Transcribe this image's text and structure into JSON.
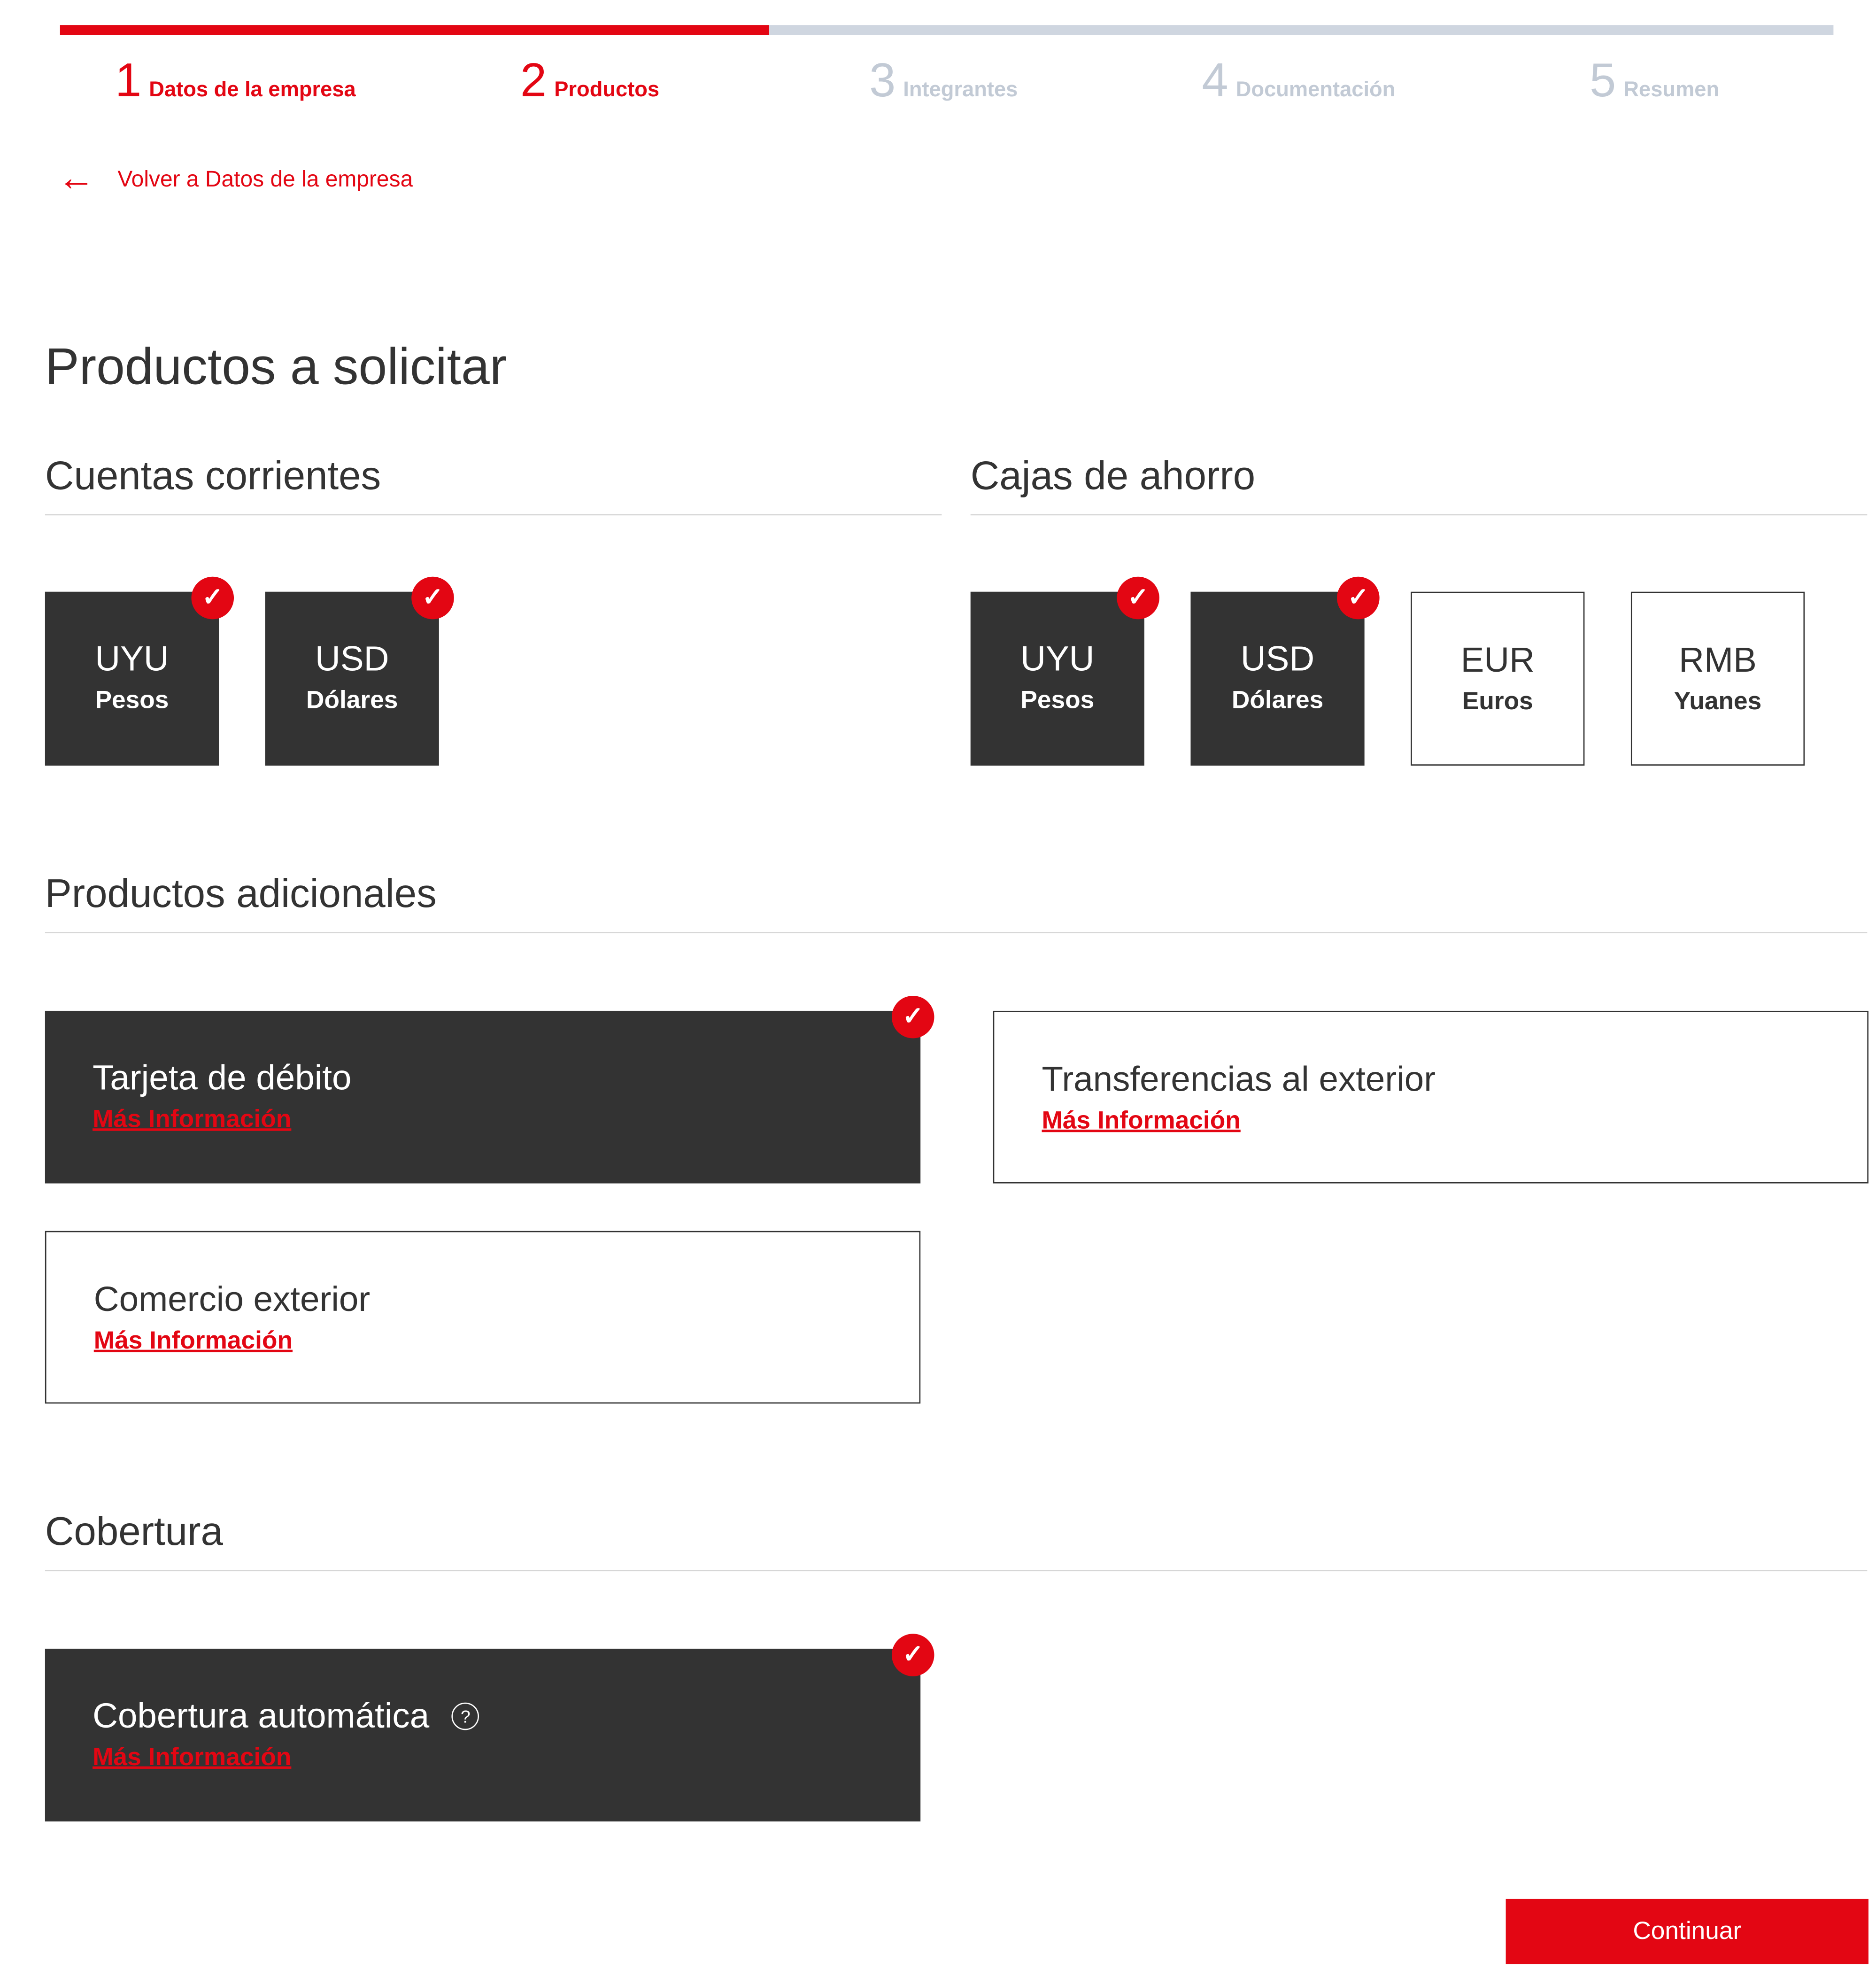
{
  "steps": [
    {
      "num": "1",
      "label": "Datos de la empresa"
    },
    {
      "num": "2",
      "label": "Productos"
    },
    {
      "num": "3",
      "label": "Integrantes"
    },
    {
      "num": "4",
      "label": "Documentación"
    },
    {
      "num": "5",
      "label": "Resumen"
    }
  ],
  "progress": {
    "current_step": 2,
    "total_steps": 5,
    "fraction": 0.4
  },
  "back_link": {
    "label": "Volver a Datos de la empresa",
    "icon": "arrow-left-icon"
  },
  "page_title": "Productos a solicitar",
  "cuentas_corrientes": {
    "title": "Cuentas corrientes",
    "tiles": [
      {
        "code": "UYU",
        "name": "Pesos",
        "selected": true
      },
      {
        "code": "USD",
        "name": "Dólares",
        "selected": true
      }
    ]
  },
  "cajas_de_ahorro": {
    "title": "Cajas de ahorro",
    "tiles": [
      {
        "code": "UYU",
        "name": "Pesos",
        "selected": true
      },
      {
        "code": "USD",
        "name": "Dólares",
        "selected": true
      },
      {
        "code": "EUR",
        "name": "Euros",
        "selected": false
      },
      {
        "code": "RMB",
        "name": "Yuanes",
        "selected": false
      }
    ]
  },
  "productos_adicionales": {
    "title": "Productos adicionales",
    "cards": [
      {
        "title": "Tarjeta de débito",
        "link": "Más Información",
        "selected": true
      },
      {
        "title": "Transferencias al exterior",
        "link": "Más Información",
        "selected": false
      },
      {
        "title": "Comercio exterior",
        "link": "Más Información",
        "selected": false
      }
    ]
  },
  "cobertura": {
    "title": "Cobertura",
    "cards": [
      {
        "title": "Cobertura automática",
        "link": "Más Información",
        "selected": true,
        "help_icon": "?"
      }
    ]
  },
  "icons": {
    "check": "✓",
    "help": "help-circle-icon"
  },
  "colors": {
    "accent": "#e30613",
    "selected_bg": "#333333",
    "pending": "#c2cad5"
  },
  "continue_label": "Continuar"
}
